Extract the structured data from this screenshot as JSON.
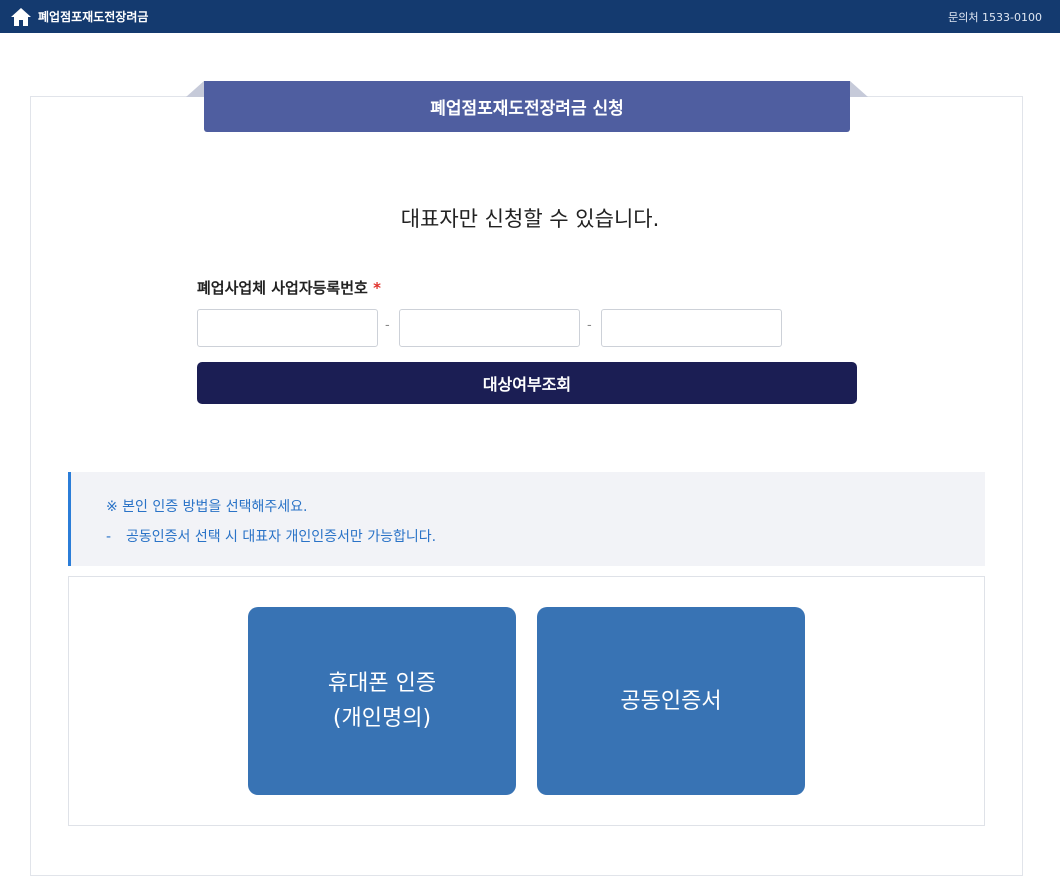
{
  "header": {
    "home_icon": "home-icon",
    "title": "폐업점포재도전장려금",
    "contact": "문의처 1533-0100"
  },
  "ribbon": {
    "title": "폐업점포재도전장려금 신청"
  },
  "notice": {
    "title": "대표자만 신청할 수 있습니다."
  },
  "form": {
    "label": "폐업사업체 사업자등록번호",
    "required_mark": "*",
    "inputs": [
      {
        "value": "",
        "placeholder": ""
      },
      {
        "value": "",
        "placeholder": ""
      },
      {
        "value": "",
        "placeholder": ""
      }
    ],
    "separator": "-",
    "submit_label": "대상여부조회"
  },
  "info": {
    "line1": "※ 본인 인증 방법을 선택해주세요.",
    "line2_prefix": "-",
    "line2": "공동인증서 선택 시 대표자 개인인증서만 가능합니다."
  },
  "auth": {
    "phone_line1": "휴대폰 인증",
    "phone_line2": "(개인명의)",
    "cert_label": "공동인증서"
  },
  "colors": {
    "topbar": "#143a6f",
    "ribbon": "#4f5ea0",
    "submit": "#1b1e54",
    "auth_button": "#3873b4",
    "info_text": "#2a73c7",
    "required": "#e0312b"
  }
}
